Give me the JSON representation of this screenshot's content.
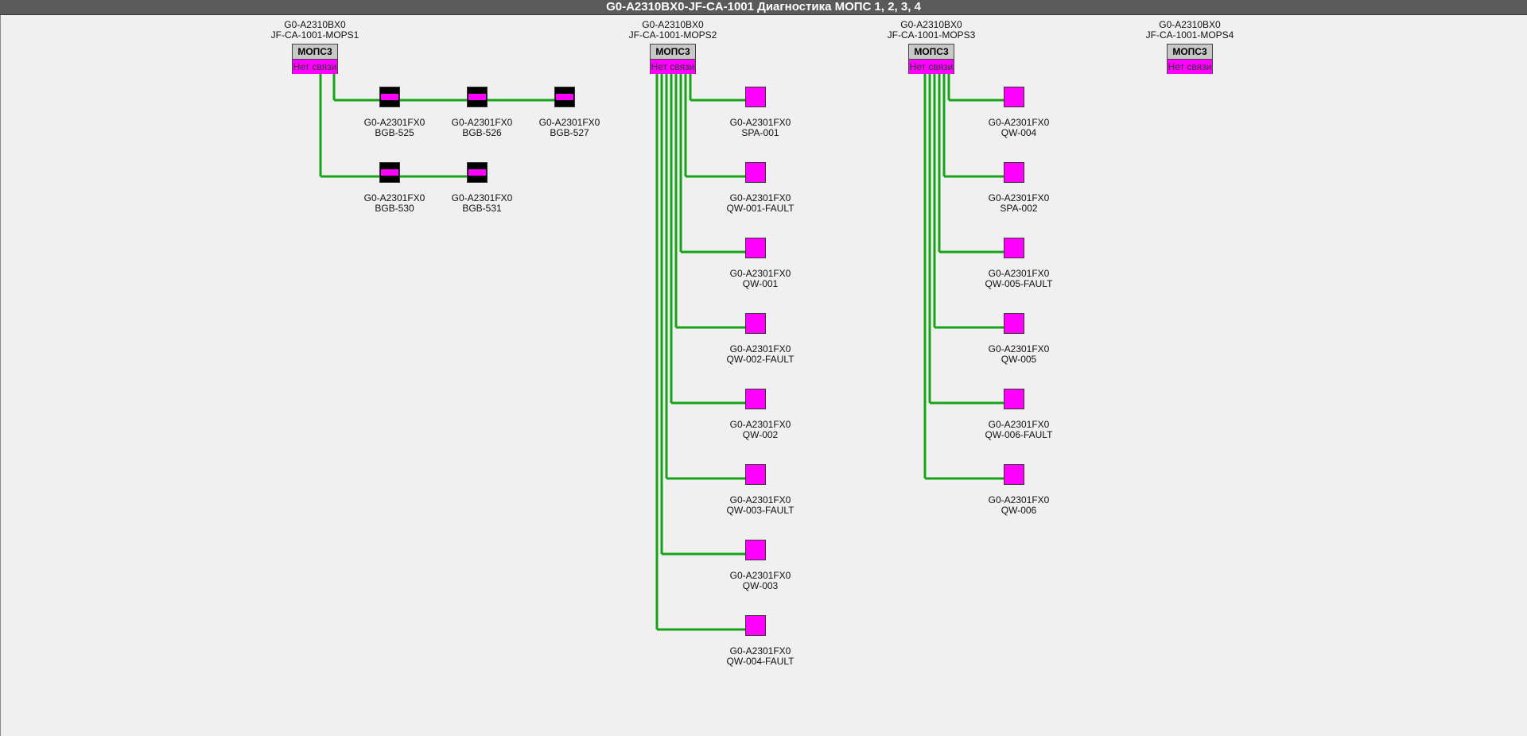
{
  "title": "G0-A2310BX0-JF-CA-1001 Диагностика МОПС 1, 2, 3, 4",
  "colors": {
    "wire": "#17a317",
    "alarm": "#ff00ff",
    "module_header": "#c8c8c8",
    "bgb_body": "#000000"
  },
  "modules": [
    {
      "line1": "G0-A2310BX0",
      "line2": "JF-CA-1001-MOPS1",
      "name": "МОПС3",
      "status": "Нет связи"
    },
    {
      "line1": "G0-A2310BX0",
      "line2": "JF-CA-1001-MOPS2",
      "name": "МОПС3",
      "status": "Нет связи"
    },
    {
      "line1": "G0-A2310BX0",
      "line2": "JF-CA-1001-MOPS3",
      "name": "МОПС3",
      "status": "Нет связи"
    },
    {
      "line1": "G0-A2310BX0",
      "line2": "JF-CA-1001-MOPS4",
      "name": "МОПС3",
      "status": "Нет связи"
    }
  ],
  "devices": [
    {
      "module": 1,
      "type": "bgb",
      "line1": "G0-A2301FX0",
      "line2": "BGB-525"
    },
    {
      "module": 1,
      "type": "bgb",
      "line1": "G0-A2301FX0",
      "line2": "BGB-526"
    },
    {
      "module": 1,
      "type": "bgb",
      "line1": "G0-A2301FX0",
      "line2": "BGB-527"
    },
    {
      "module": 1,
      "type": "bgb",
      "line1": "G0-A2301FX0",
      "line2": "BGB-530"
    },
    {
      "module": 1,
      "type": "bgb",
      "line1": "G0-A2301FX0",
      "line2": "BGB-531"
    },
    {
      "module": 2,
      "type": "sq",
      "line1": "G0-A2301FX0",
      "line2": "SPA-001"
    },
    {
      "module": 2,
      "type": "sq",
      "line1": "G0-A2301FX0",
      "line2": "QW-001-FAULT"
    },
    {
      "module": 2,
      "type": "sq",
      "line1": "G0-A2301FX0",
      "line2": "QW-001"
    },
    {
      "module": 2,
      "type": "sq",
      "line1": "G0-A2301FX0",
      "line2": "QW-002-FAULT"
    },
    {
      "module": 2,
      "type": "sq",
      "line1": "G0-A2301FX0",
      "line2": "QW-002"
    },
    {
      "module": 2,
      "type": "sq",
      "line1": "G0-A2301FX0",
      "line2": "QW-003-FAULT"
    },
    {
      "module": 2,
      "type": "sq",
      "line1": "G0-A2301FX0",
      "line2": "QW-003"
    },
    {
      "module": 2,
      "type": "sq",
      "line1": "G0-A2301FX0",
      "line2": "QW-004-FAULT"
    },
    {
      "module": 3,
      "type": "sq",
      "line1": "G0-A2301FX0",
      "line2": "QW-004"
    },
    {
      "module": 3,
      "type": "sq",
      "line1": "G0-A2301FX0",
      "line2": "SPA-002"
    },
    {
      "module": 3,
      "type": "sq",
      "line1": "G0-A2301FX0",
      "line2": "QW-005-FAULT"
    },
    {
      "module": 3,
      "type": "sq",
      "line1": "G0-A2301FX0",
      "line2": "QW-005"
    },
    {
      "module": 3,
      "type": "sq",
      "line1": "G0-A2301FX0",
      "line2": "QW-006-FAULT"
    },
    {
      "module": 3,
      "type": "sq",
      "line1": "G0-A2301FX0",
      "line2": "QW-006"
    }
  ]
}
